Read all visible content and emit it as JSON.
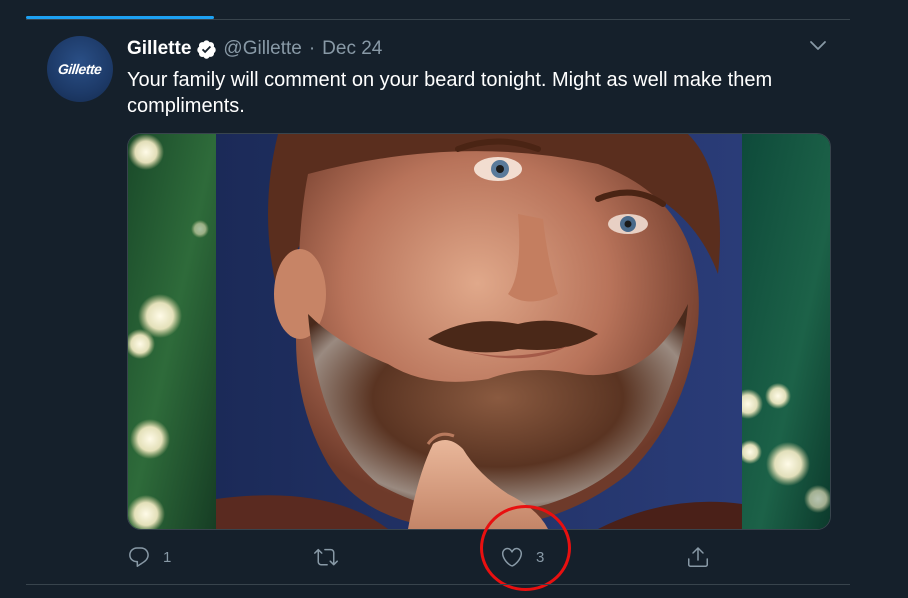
{
  "tweet": {
    "avatar_logo_text": "Gillette",
    "display_name": "Gillette",
    "handle": "@Gillette",
    "separator": "·",
    "date": "Dec 24",
    "text": "Your family will comment on your beard tonight. Might as well make them compliments.",
    "media_icon": "photo-of-bearded-man"
  },
  "actions": {
    "reply": {
      "icon": "reply-icon",
      "count": "1"
    },
    "retweet": {
      "icon": "retweet-icon",
      "count": ""
    },
    "like": {
      "icon": "heart-icon",
      "count": "3"
    },
    "share": {
      "icon": "share-icon",
      "count": ""
    }
  },
  "colors": {
    "background": "#15202b",
    "muted_text": "#8899a6",
    "divider": "#38444d",
    "accent": "#1da1f2",
    "annotation": "#e81010"
  }
}
